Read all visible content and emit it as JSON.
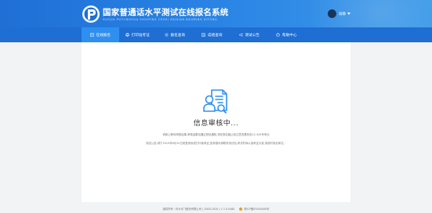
{
  "header": {
    "title": "国家普通话水平测试在线报名系统",
    "subtitle": "GUOJIA PUTONGHUA SHUIPING CESHI ZAIXIAN BAOMING XITONG",
    "user_name": "翁静"
  },
  "nav": {
    "items": [
      {
        "label": "在线报名",
        "icon": "form-icon"
      },
      {
        "label": "打印准考证",
        "icon": "printer-icon"
      },
      {
        "label": "报名查询",
        "icon": "list-icon"
      },
      {
        "label": "成绩查询",
        "icon": "chart-icon"
      },
      {
        "label": "测试公告",
        "icon": "megaphone-icon"
      },
      {
        "label": "帮助中心",
        "icon": "help-icon"
      }
    ],
    "active_index": 0
  },
  "status": {
    "title": "信息审核中...",
    "message1": "请耐心等待审核结果,审核结果将通过短信通知,请在报名截止前注意查看状态12-345号考点",
    "message2": "测试公告:请于2019年6月10日前登录系统打印准考证,如有疑问请联系测试站,考试时间以准考证为准,请准时参加考试。"
  },
  "footer": {
    "copyright": "版权所有 : 科大讯飞股份有限公司 | 2008-2020 | V 2.0.0460",
    "beian": "皖ICP备05000000号"
  },
  "colors": {
    "header_blue": "#1f6fd6",
    "nav_blue": "#1e6ed3",
    "nav_active": "#2f8ff0",
    "accent": "#2f8ff0"
  }
}
